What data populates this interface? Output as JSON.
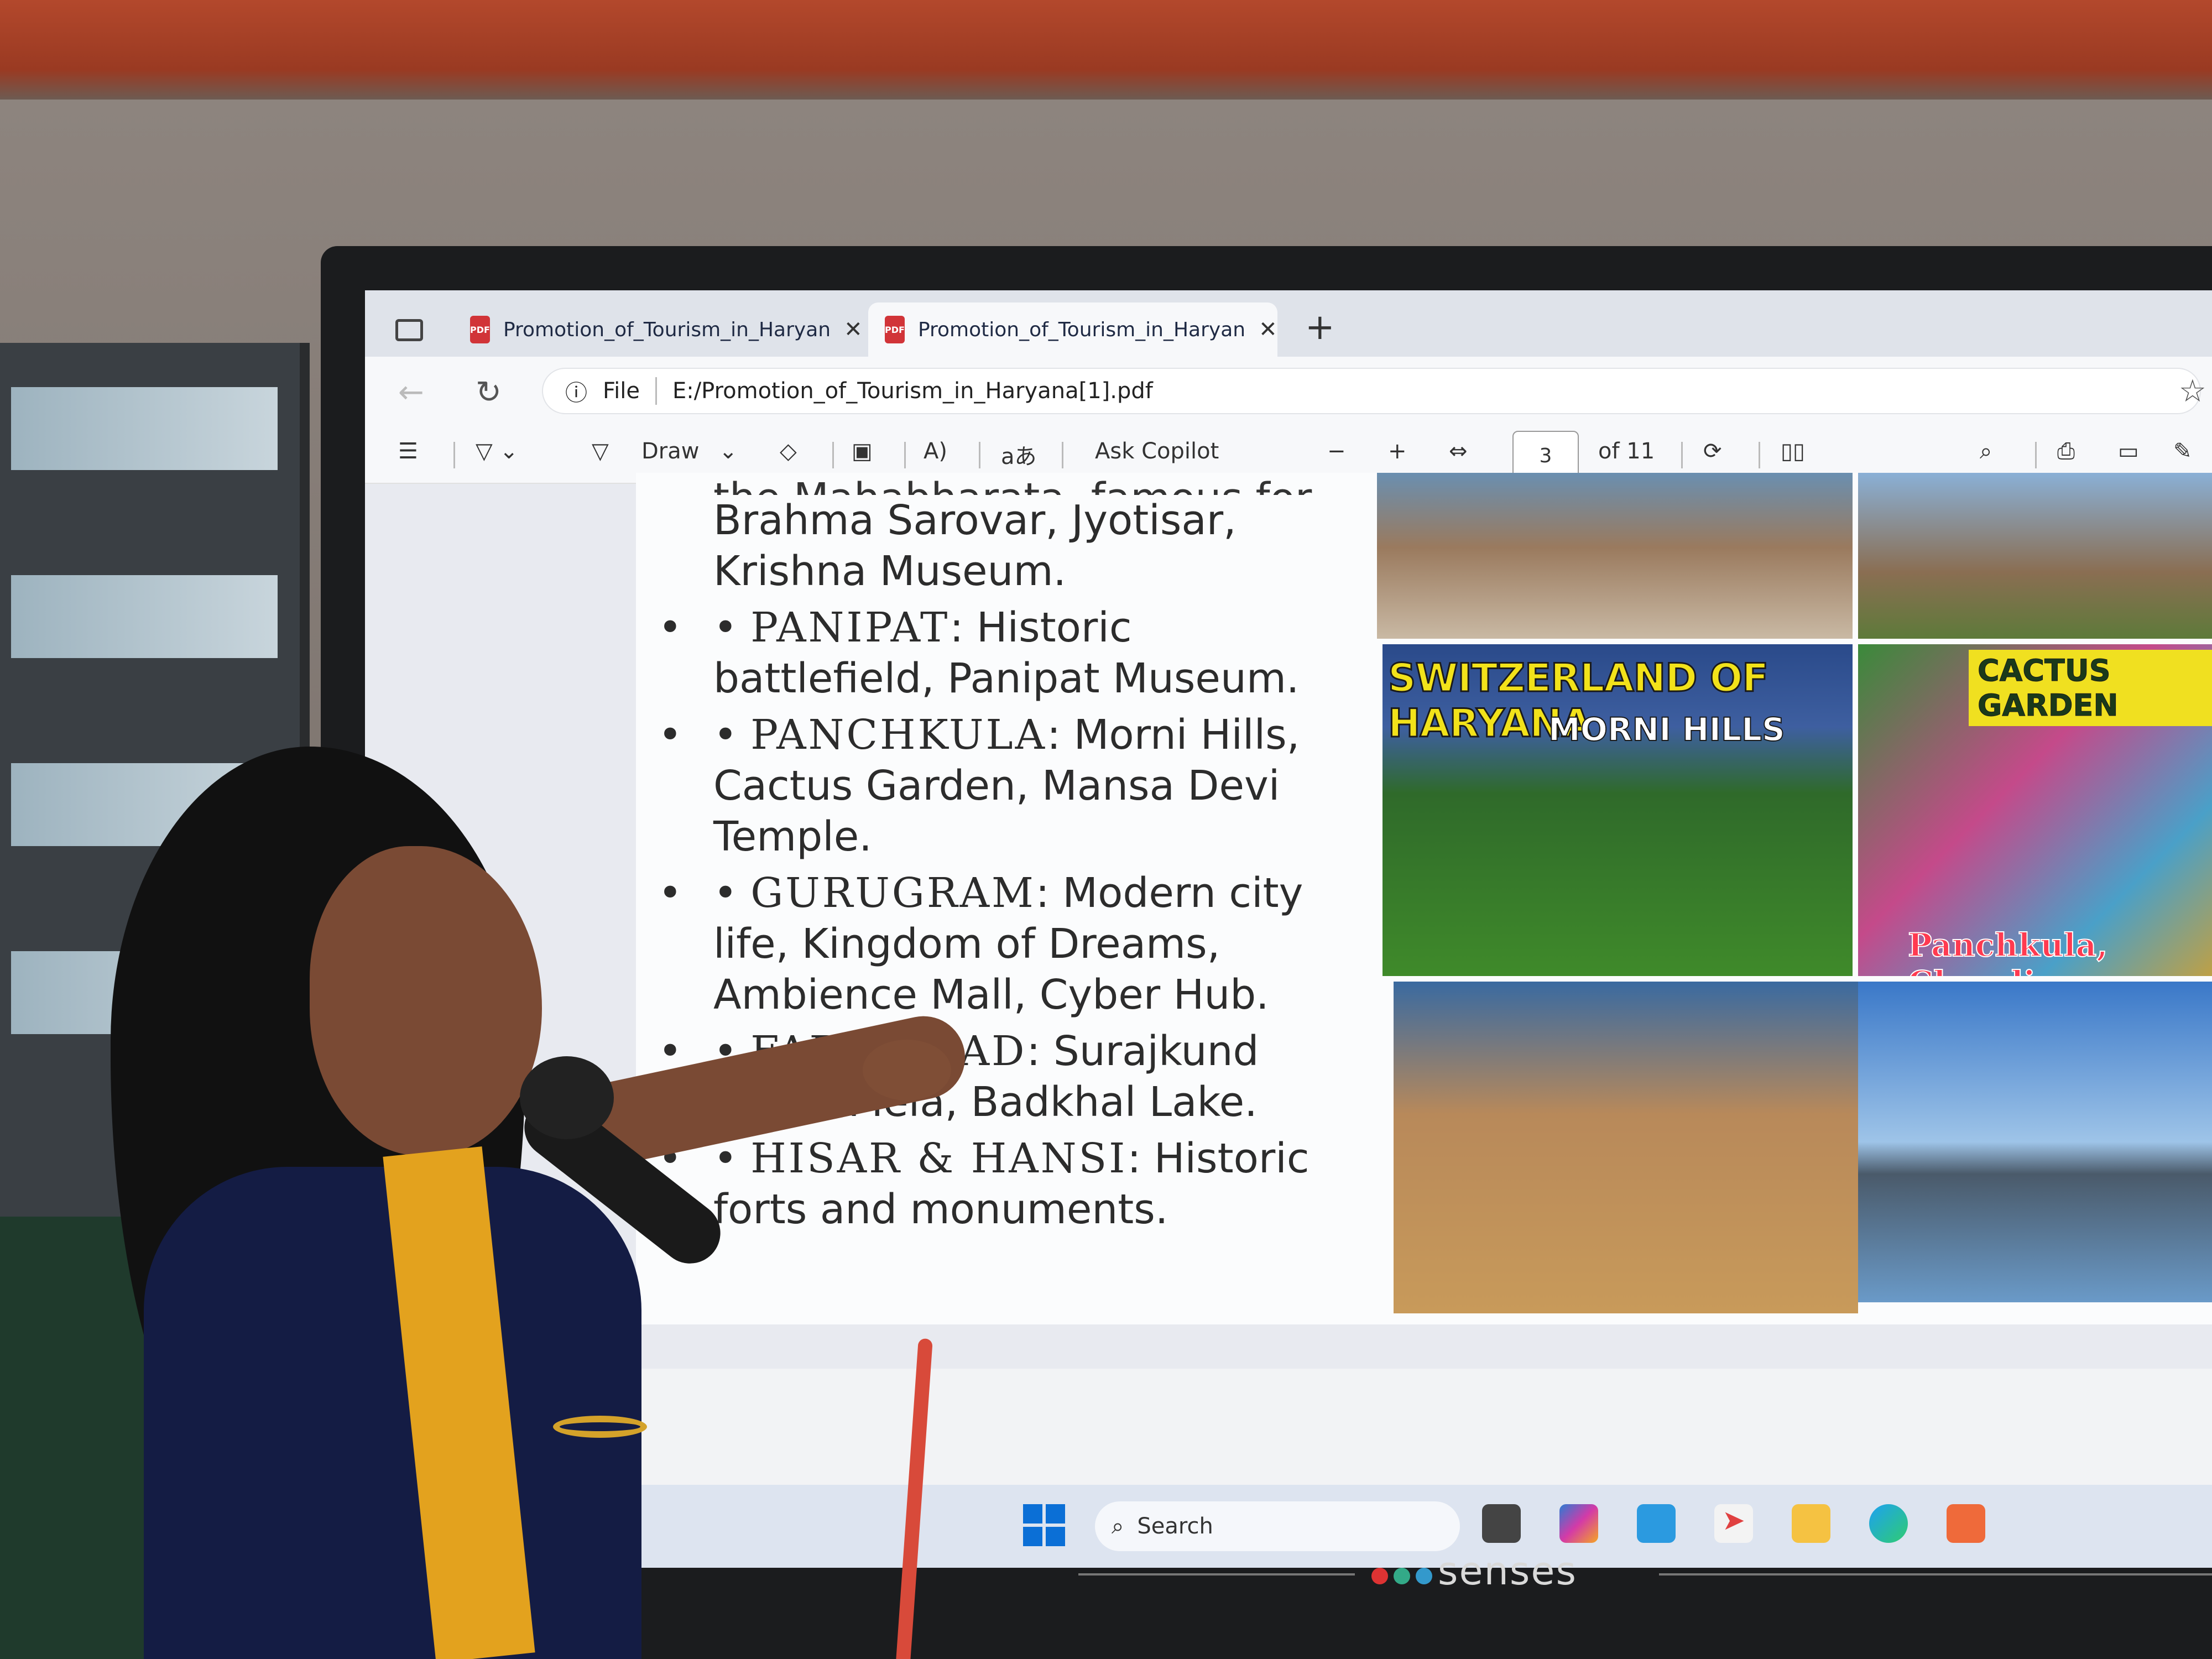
{
  "browser": {
    "tabs": [
      {
        "label": "Promotion_of_Tourism_in_Haryan",
        "active": false
      },
      {
        "label": "Promotion_of_Tourism_in_Haryan",
        "active": true
      }
    ],
    "new_tab": "+",
    "address": {
      "info_label": "File",
      "url": "E:/Promotion_of_Tourism_in_Haryana[1].pdf"
    }
  },
  "pdf_toolbar": {
    "draw_label": "Draw",
    "ask_copilot_label": "Ask Copilot",
    "zoom_out": "−",
    "zoom_in": "+",
    "current_page": "3",
    "page_count": "of 11"
  },
  "slide": {
    "cut_line": "the Mahabharata, famous for",
    "continuation": "Brahma Sarovar, Jyotisar, Krishna Museum.",
    "bullets": [
      {
        "marker": "•",
        "city": "PANIPAT",
        "sep": ":",
        "desc": " Historic battlefield, Panipat Museum."
      },
      {
        "marker": "•",
        "city": "PANCHKULA",
        "sep": ":",
        "desc": " Morni Hills, Cactus Garden, Mansa Devi Temple."
      },
      {
        "marker": "•",
        "city": "GURUGRAM",
        "sep": ":",
        "desc": " Modern city life, Kingdom of Dreams, Ambience Mall, Cyber Hub."
      },
      {
        "marker": "•",
        "city": "FARIDABAD",
        "sep": ":",
        "desc": " Surajkund Crafts Mela, Badkhal Lake."
      },
      {
        "marker": "•",
        "city": "HISAR & HANSI",
        "sep": ":",
        "desc": " Historic forts and monuments."
      }
    ],
    "photo_labels": {
      "morni_title": "SWITZERLAND OF HARYANA",
      "morni_sub": "MORNI HILLS",
      "cactus_title": "CACTUS GARDEN",
      "cactus_sub": "Panchkula, Chandiga"
    }
  },
  "taskbar": {
    "search_placeholder": "Search"
  },
  "monitor": {
    "brand": "senses"
  },
  "colors": {
    "accent": "#0b6fd6",
    "pdf_red": "#d13438",
    "ceiling": "#b3482c",
    "shirt": "#141c44"
  }
}
